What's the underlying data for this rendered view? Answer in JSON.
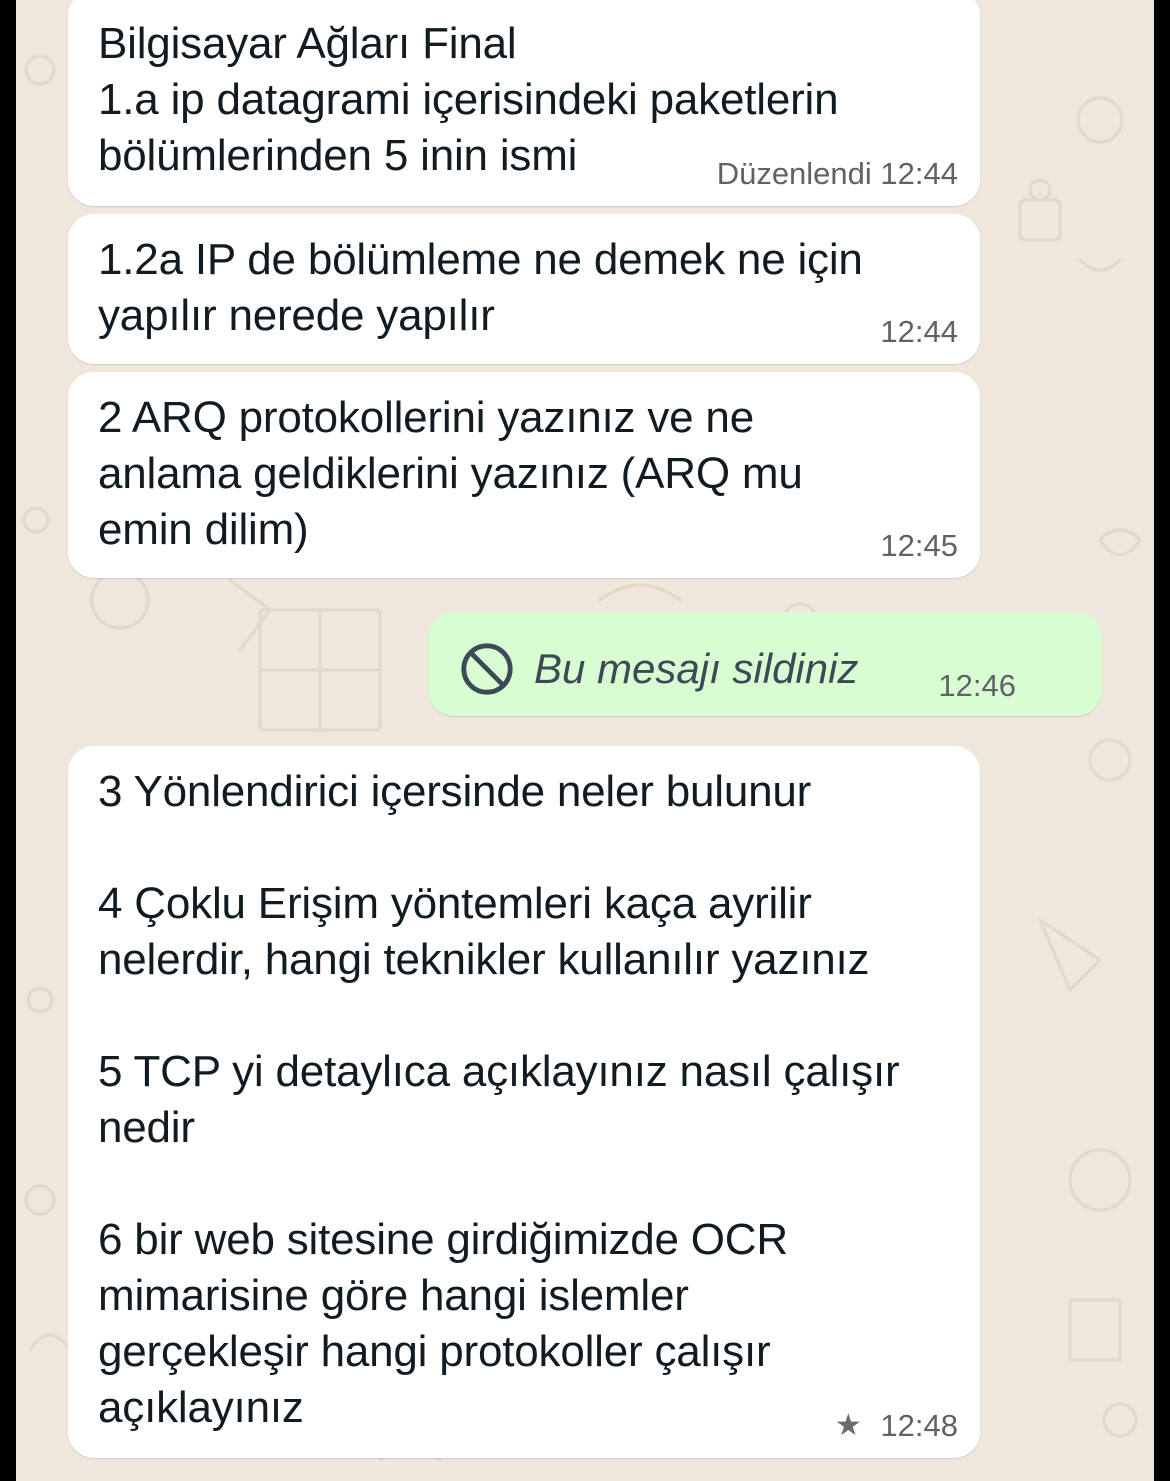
{
  "conversation": {
    "messages": [
      {
        "id": "m1",
        "text": "Bilgisayar Ağları Final\n1.a ip datagrami içerisindeki paketlerin\nbölümlerinden 5 inin ismi",
        "time": "12:44",
        "edited_label": "Düzenlendi"
      },
      {
        "id": "m2",
        "text": "1.2a IP de bölümleme ne demek ne için\nyapılır nerede yapılır",
        "time": "12:44"
      },
      {
        "id": "m3",
        "text": "2 ARQ protokollerini yazınız ve ne\nanlama geldiklerini yazınız (ARQ mu\nemin dilim)",
        "time": "12:45"
      },
      {
        "id": "m4",
        "deleted_text": "Bu mesajı sildiniz",
        "time": "12:46",
        "icon": "deleted-message-icon"
      },
      {
        "id": "m5",
        "text": "3 Yönlendirici içersinde neler bulunur\n\n4 Çoklu Erişim yöntemleri kaça ayrilir\nnelerdir, hangi teknikler kullanılır yazınız\n\n5 TCP yi detaylıca açıklayınız nasıl çalışır\nnedir\n\n6 bir web sitesine girdiğimizde OCR\nmimarisine göre hangi islemler\ngerçekleşir hangi protokoller çalışır\naçıklayınız",
        "time": "12:48",
        "starred_icon": "star-icon"
      }
    ]
  },
  "colors": {
    "incoming_bubble": "#ffffff",
    "outgoing_bubble": "#d9fdd3",
    "wallpaper": "#efe7dc",
    "text": "#111b21",
    "meta": "#5f6368"
  }
}
